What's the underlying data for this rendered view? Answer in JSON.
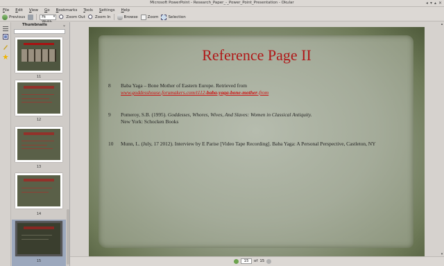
{
  "window": {
    "title": "Microsoft PowerPoint - Research_Paper_-_Power_Point_Presentation - Okular",
    "controls": [
      "◂",
      "▾",
      "▴",
      "✕"
    ]
  },
  "menu": [
    "File",
    "Edit",
    "View",
    "Go",
    "Bookmarks",
    "Tools",
    "Settings",
    "Help"
  ],
  "toolbar": {
    "previous": "Previous",
    "zoom_value": "Fit Width",
    "zoom_out": "Zoom Out",
    "zoom_in": "Zoom In",
    "browse": "Browse",
    "zoom": "Zoom",
    "selection": "Selection"
  },
  "thumbnails": {
    "title": "Thumbnails",
    "pages": [
      {
        "number": "11",
        "selected": false
      },
      {
        "number": "12",
        "selected": false
      },
      {
        "number": "13",
        "selected": false
      },
      {
        "number": "14",
        "selected": false
      },
      {
        "number": "15",
        "selected": true
      }
    ]
  },
  "slide": {
    "title": "Reference Page II",
    "references": [
      {
        "number": "8",
        "text": "Baba Yaga – Bone Mother of Eastern Europe.  Retrieved from",
        "link_prefix": "www.goddesshouse.forumakers.com/t112-",
        "link_bold": "baba-yaga-bone-mother",
        "link_suffix": "-from"
      },
      {
        "number": "9",
        "text_a": "Pomeroy, S.B.  (1995).  ",
        "text_italic": "Goddesses, Whores, Wives, And Slaves: Women  in Classical Antiquity.",
        "text_b": "New York: Schocken Books"
      },
      {
        "number": "10",
        "text": "Munn, L. (July, 17 2012). Interview by E Parise [Video Tape Recording]. Baba Yaga: A Personal Perspective, Castleton, NY"
      }
    ]
  },
  "status": {
    "current_page": "15",
    "of_label": "of",
    "total_pages": "15"
  },
  "colors": {
    "title_red": "#b01818",
    "link_red": "#cc1111",
    "selection_blue": "#9ca8bd"
  }
}
